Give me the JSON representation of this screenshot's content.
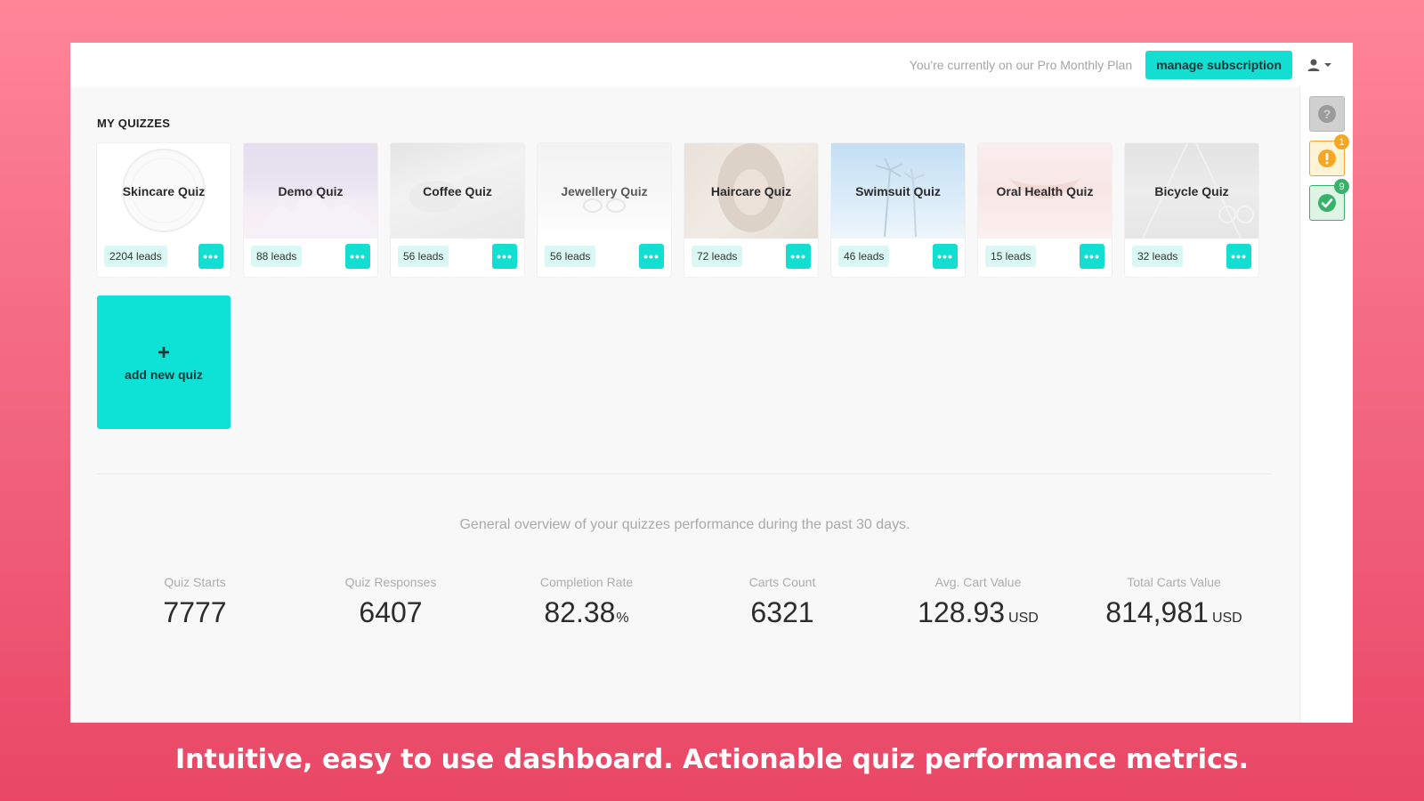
{
  "header": {
    "plan_text": "You're currently on our Pro Monthly Plan",
    "manage_label": "manage subscription",
    "user_icon": "user-icon"
  },
  "sidebar": {
    "help_icon": "question-icon",
    "alert": {
      "icon": "warning-icon",
      "badge": "1",
      "color": "#f6a623"
    },
    "done": {
      "icon": "check-circle-icon",
      "badge": "9",
      "color": "#38b26a"
    }
  },
  "quizzes": {
    "section_title": "MY QUIZZES",
    "items": [
      {
        "title": "Skincare Quiz",
        "leads": "2204 leads"
      },
      {
        "title": "Demo Quiz",
        "leads": "88 leads"
      },
      {
        "title": "Coffee Quiz",
        "leads": "56 leads"
      },
      {
        "title": "Jewellery Quiz",
        "leads": "56 leads"
      },
      {
        "title": "Haircare Quiz",
        "leads": "72 leads"
      },
      {
        "title": "Swimsuit Quiz",
        "leads": "46 leads"
      },
      {
        "title": "Oral Health Quiz",
        "leads": "15 leads"
      },
      {
        "title": "Bicycle Quiz",
        "leads": "32 leads"
      }
    ],
    "more_label": "•••",
    "add_new": {
      "plus": "+",
      "label": "add new quiz"
    }
  },
  "overview": {
    "text": "General overview of your quizzes performance during the past 30 days.",
    "metrics": [
      {
        "label": "Quiz Starts",
        "value": "7777",
        "unit": ""
      },
      {
        "label": "Quiz Responses",
        "value": "6407",
        "unit": ""
      },
      {
        "label": "Completion Rate",
        "value": "82.38",
        "unit": "%"
      },
      {
        "label": "Carts Count",
        "value": "6321",
        "unit": ""
      },
      {
        "label": "Avg. Cart Value",
        "value": "128.93",
        "unit": "USD"
      },
      {
        "label": "Total Carts Value",
        "value": "814,981",
        "unit": "USD"
      }
    ]
  },
  "caption": "Intuitive, easy to use dashboard. Actionable quiz performance metrics.",
  "colors": {
    "accent": "#12dfd2",
    "background_top": "#ff8597",
    "background_bottom": "#e94765"
  }
}
